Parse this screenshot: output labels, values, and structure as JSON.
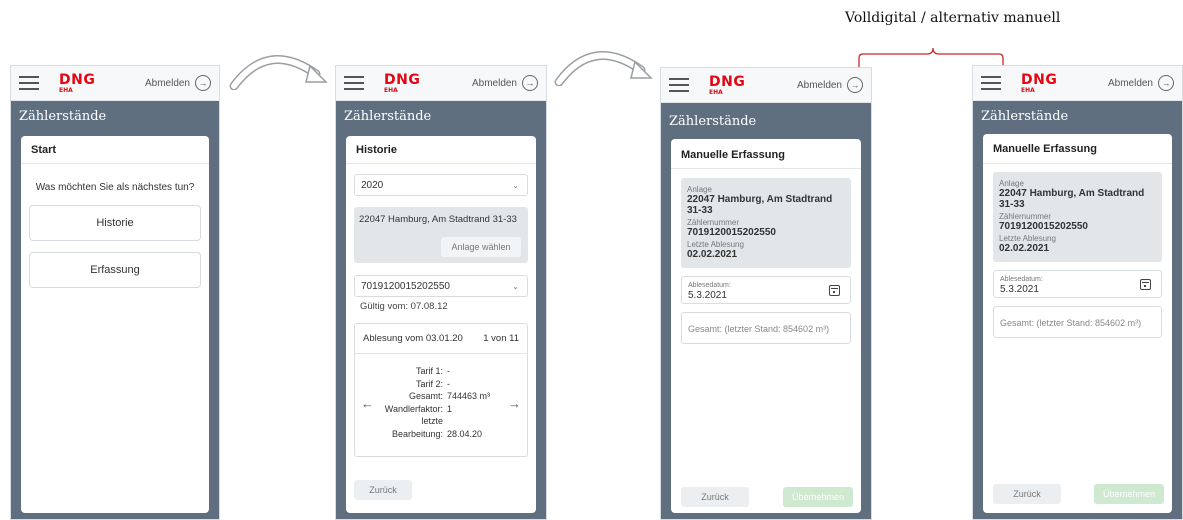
{
  "caption": "Volldigital / alternativ manuell",
  "common": {
    "logo_main": "DNG",
    "logo_sub": "EHA",
    "logout_label": "Abmelden",
    "logout_icon": "arrow-circle-right-icon",
    "menu_icon": "hamburger-menu-icon",
    "screen_title": "Zählerstände"
  },
  "screen1": {
    "card_title": "Start",
    "question": "Was möchten Sie als nächstes tun?",
    "buttons": [
      "Historie",
      "Erfassung"
    ]
  },
  "screen2": {
    "card_title": "Historie",
    "year_select": "2020",
    "address": "22047 Hamburg, Am Stadtrand 31-33",
    "select_plant_button": "Anlage wählen",
    "meter_select": "7019120015202550",
    "valid_from": "Gültig vom: 07.08.12",
    "reading_header": "Ablesung vom 03.01.20",
    "reading_counter": "1 von 11",
    "details": [
      {
        "label": "Tarif 1:",
        "value": "-"
      },
      {
        "label": "Tarif 2:",
        "value": "-"
      },
      {
        "label": "Gesamt:",
        "value": "744463 m³"
      },
      {
        "label": "Wandlerfaktor:",
        "value": "1"
      },
      {
        "label": "letzte",
        "value": ""
      },
      {
        "label": "Bearbeitung:",
        "value": "28.04.20"
      }
    ],
    "back_button": "Zurück"
  },
  "screen_manual": {
    "card_title": "Manuelle Erfassung",
    "plant_label": "Anlage",
    "plant_value": "22047 Hamburg, Am Stadtrand 31-33",
    "meter_label": "Zählernummer",
    "meter_value": "7019120015202550",
    "last_reading_label": "Letzte Ablesung",
    "last_reading_value": "02.02.2021",
    "date_field_label": "Ablesedatum:",
    "date_field_value": "5.3.2021",
    "total_placeholder": "Gesamt: (letzter Stand: 854602 m³)",
    "back_button": "Zurück",
    "submit_button": "Übernehmen"
  }
}
